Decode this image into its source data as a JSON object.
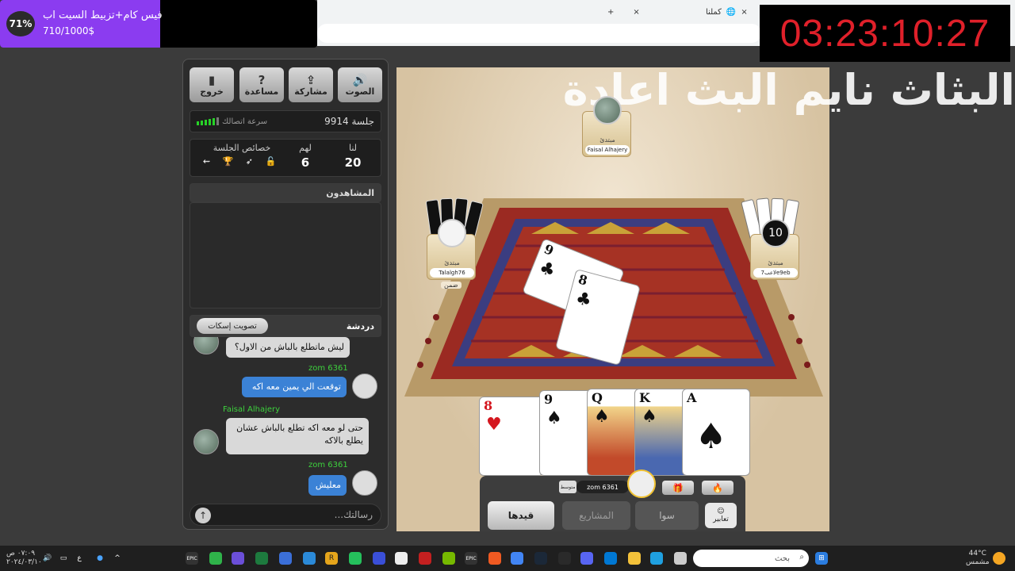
{
  "browser": {
    "tab_active": "كملنا",
    "tab_close_glyph": "×",
    "new_tab_glyph": "+"
  },
  "donation": {
    "percent": "71%",
    "percent_value": 0.71,
    "title": "فيس كام+تزبيط السيت اب",
    "amount": "710/1000$"
  },
  "timer": "03:23:10:27",
  "overlay_text": "البثاث نايم البث اعادة",
  "panel": {
    "toolbar": {
      "sound": "الصوت",
      "share": "مشاركة",
      "help": "مساعدة",
      "exit": "خروج"
    },
    "session": {
      "label": "جلسة 9914",
      "speed_label": "سرعة اتصالك"
    },
    "score": {
      "us_label": "لنا",
      "us_value": "20",
      "them_label": "لهم",
      "them_value": "6",
      "props_label": "خصائص الجلسة",
      "props_icons": "⇜ 🏆 ➶ 🔓"
    },
    "viewers_title": "المشاهدون",
    "chat": {
      "title": "دردشة",
      "mute_button": "تصويت إسكات",
      "input_placeholder": "رسالتك...",
      "send_glyph": "↑",
      "messages": [
        {
          "sender": "",
          "text": "ليش ماتطلع بالباش من الاول؟",
          "style": "grey"
        },
        {
          "sender": "zom 6361",
          "text": "توقعت الي يمين معه اكه",
          "style": "blue"
        },
        {
          "sender": "Faisal Alhajery",
          "text": "حتى لو معه اكه تطلع بالباش عشان يطلع بالاكه",
          "style": "grey"
        },
        {
          "sender": "zom 6361",
          "text": "معليش",
          "style": "blue"
        }
      ]
    }
  },
  "game": {
    "players": {
      "top": {
        "tag": "مبتدئ",
        "name": "Faisal Alhajery"
      },
      "left": {
        "tag": "مبتدئ",
        "name": "Talalgh76",
        "sub": "ضمن"
      },
      "right": {
        "tag": "مبتدئ",
        "name": "لاعب7e9eb",
        "timer": "10"
      }
    },
    "table_cards": [
      {
        "rank": "9",
        "suit": "♣",
        "color": "black"
      },
      {
        "rank": "8",
        "suit": "♣",
        "color": "black"
      }
    ],
    "hand": [
      {
        "rank": "8",
        "suit": "♥",
        "color": "red"
      },
      {
        "rank": "9",
        "suit": "♠",
        "color": "black"
      },
      {
        "rank": "Q",
        "suit": "♠",
        "color": "black"
      },
      {
        "rank": "K",
        "suit": "♠",
        "color": "black"
      },
      {
        "rank": "A",
        "suit": "♠",
        "color": "black"
      }
    ],
    "tray": {
      "my_name": "zom 6361",
      "my_level": "متوسط",
      "btn_qaydha": "قيدها",
      "btn_mashari": "المشاريع",
      "btn_sawa": "سوا",
      "btn_expressions": "تعابير"
    }
  },
  "taskbar": {
    "search_placeholder": "بحث",
    "time": "٠٧:٠٩ ص",
    "date": "٢٠٢٤/٠٣/١٠",
    "weather_temp": "44°C",
    "weather_text": "مشمس",
    "lang": "ع",
    "epic_label": "EPIC",
    "r_label": "R"
  }
}
